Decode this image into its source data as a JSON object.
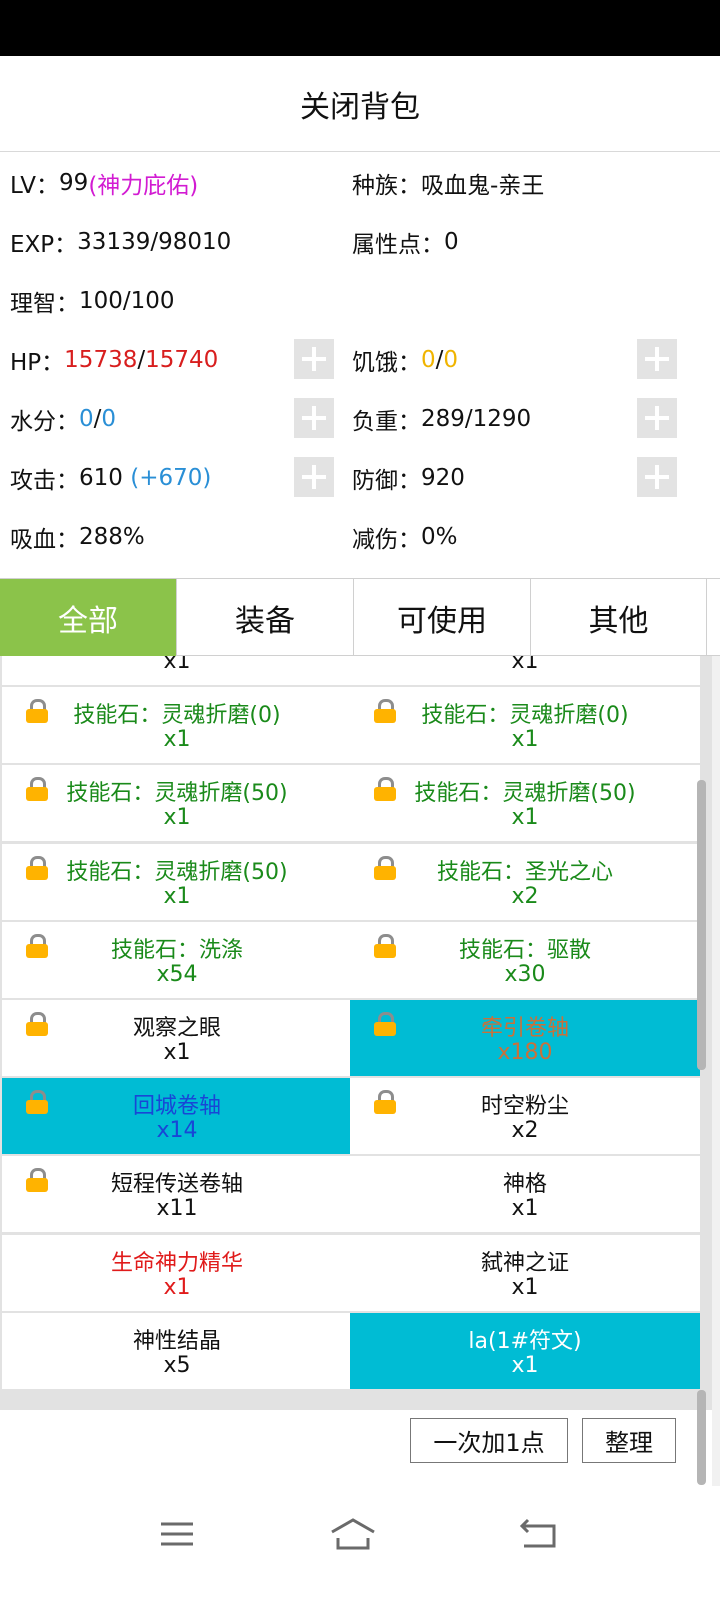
{
  "header": {
    "title": "关闭背包"
  },
  "stats": {
    "lv_label": "LV：",
    "lv_value": "99",
    "lv_bonus": "(神力庇佑)",
    "race_label": "种族：",
    "race_value": "吸血鬼-亲王",
    "exp_label": "EXP：",
    "exp_value": "33139/98010",
    "attr_label": "属性点：",
    "attr_value": "0",
    "sanity_label": "理智：",
    "sanity_value": "100/100",
    "hp_label": "HP：",
    "hp_cur": "15738",
    "hp_sep": "/",
    "hp_max": "15740",
    "hunger_label": "饥饿：",
    "hunger_cur": "0",
    "hunger_sep": "/",
    "hunger_max": "0",
    "water_label": "水分：",
    "water_cur": "0",
    "water_sep": "/",
    "water_max": "0",
    "load_label": "负重：",
    "load_value": "289/1290",
    "atk_label": "攻击：",
    "atk_value": "610 ",
    "atk_bonus": "(+670)",
    "def_label": "防御：",
    "def_value": "920",
    "lifesteal_label": "吸血：",
    "lifesteal_value": "288%",
    "reduce_label": "减伤：",
    "reduce_value": "0%"
  },
  "tabs": [
    {
      "label": "全部",
      "active": true
    },
    {
      "label": "装备",
      "active": false
    },
    {
      "label": "可使用",
      "active": false
    },
    {
      "label": "其他",
      "active": false
    }
  ],
  "items": [
    {
      "name": "",
      "count": "x1"
    },
    {
      "name": "",
      "count": "x1"
    },
    {
      "name": "技能石：灵魂折磨(0)",
      "count": "x1",
      "locked": true,
      "color": "green"
    },
    {
      "name": "技能石：灵魂折磨(0)",
      "count": "x1",
      "locked": true,
      "color": "green"
    },
    {
      "name": "技能石：灵魂折磨(50)",
      "count": "x1",
      "locked": true,
      "color": "green"
    },
    {
      "name": "技能石：灵魂折磨(50)",
      "count": "x1",
      "locked": true,
      "color": "green"
    },
    {
      "name": "技能石：灵魂折磨(50)",
      "count": "x1",
      "locked": true,
      "color": "green"
    },
    {
      "name": "技能石：圣光之心",
      "count": "x2",
      "locked": true,
      "color": "green"
    },
    {
      "name": "技能石：洗涤",
      "count": "x54",
      "locked": true,
      "color": "green"
    },
    {
      "name": "技能石：驱散",
      "count": "x30",
      "locked": true,
      "color": "green"
    },
    {
      "name": "观察之眼",
      "count": "x1",
      "locked": true,
      "color": "black"
    },
    {
      "name": "牵引卷轴",
      "count": "x180",
      "locked": true,
      "color": "orange",
      "selected": true
    },
    {
      "name": "回城卷轴",
      "count": "x14",
      "locked": true,
      "color": "blue",
      "selected": true
    },
    {
      "name": "时空粉尘",
      "count": "x2",
      "locked": true,
      "color": "black"
    },
    {
      "name": "短程传送卷轴",
      "count": "x11",
      "locked": true,
      "color": "black"
    },
    {
      "name": "神格",
      "count": "x1",
      "locked": false,
      "color": "black"
    },
    {
      "name": "生命神力精华",
      "count": "x1",
      "locked": false,
      "color": "red"
    },
    {
      "name": "弑神之证",
      "count": "x1",
      "locked": false,
      "color": "black"
    },
    {
      "name": "神性结晶",
      "count": "x5",
      "locked": false,
      "color": "black"
    },
    {
      "name": "la(1#符文)",
      "count": "x1",
      "locked": false,
      "color": "white",
      "selected": true
    }
  ],
  "buttons": {
    "add_one": "一次加1点",
    "sort": "整理"
  },
  "nav_icons": [
    "menu-icon",
    "home-icon",
    "back-icon"
  ]
}
